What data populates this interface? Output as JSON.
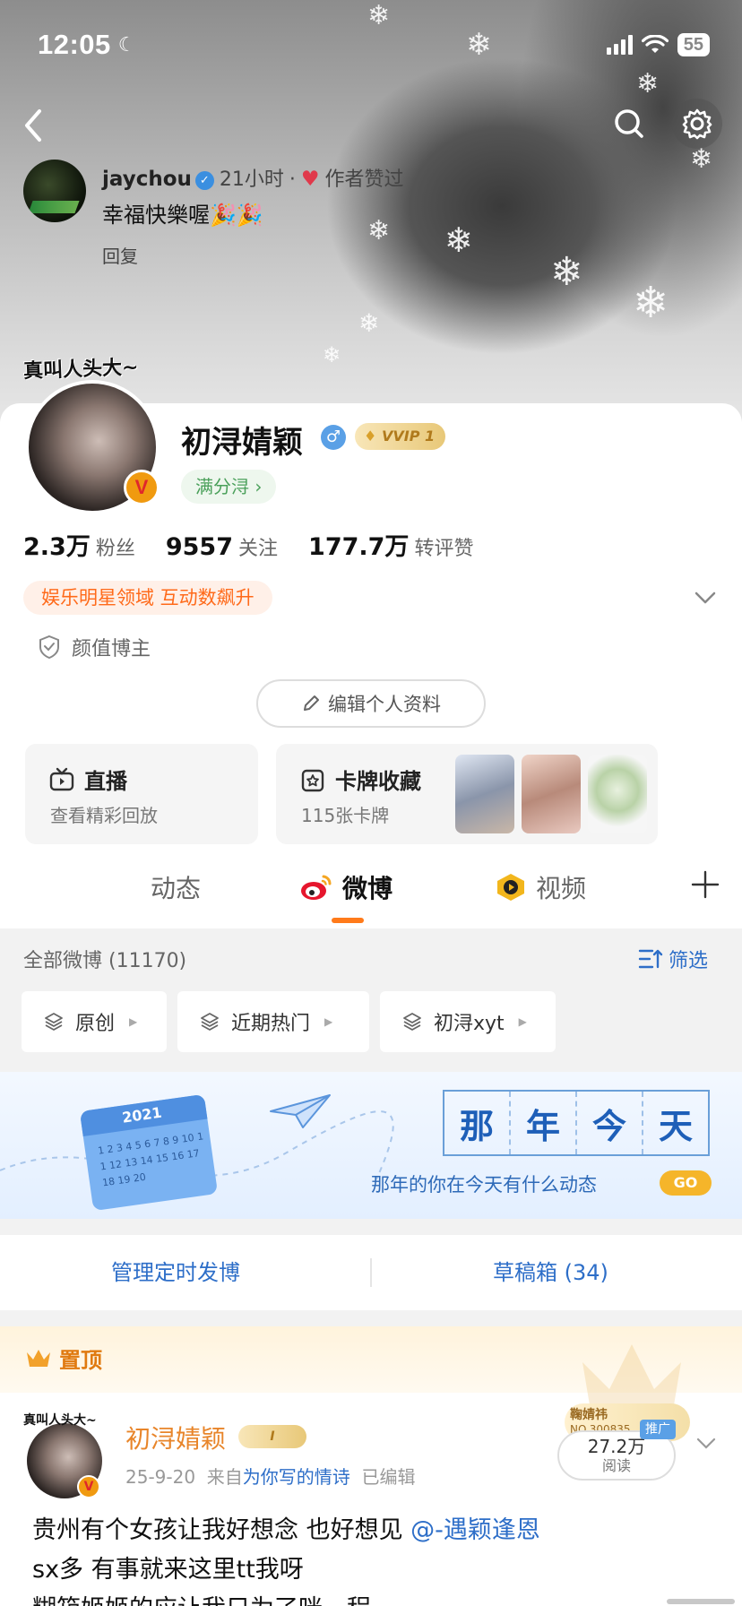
{
  "status_bar": {
    "time": "12:05",
    "battery": "55"
  },
  "header": {
    "back": "back-arrow-icon",
    "search": "search-icon",
    "settings": "gear-icon"
  },
  "top_comment": {
    "user": "jaychou",
    "time": "21小时",
    "liked_by_author": "作者赞过",
    "text": "幸福快樂喔🎉🎉",
    "reply": "回复"
  },
  "profile": {
    "avatar_tag": "真叫人头大~",
    "name": "初浔婧颖",
    "gender_icon": "♂",
    "vip": "VVIP 1",
    "score_tag": "满分浔 ›",
    "stats": [
      {
        "num": "2.3万",
        "label": "粉丝"
      },
      {
        "num": "9557",
        "label": "关注"
      },
      {
        "num": "177.7万",
        "label": "转评赞"
      }
    ],
    "domain_tag": "娱乐明星领域 互动数飙升",
    "category": "颜值博主",
    "edit_button": "编辑个人资料"
  },
  "tiles": {
    "live": {
      "title": "直播",
      "sub": "查看精彩回放"
    },
    "cards": {
      "title": "卡牌收藏",
      "sub": "115张卡牌"
    }
  },
  "tabs": [
    {
      "label": "动态",
      "active": false
    },
    {
      "label": "微博",
      "active": true
    },
    {
      "label": "视频",
      "active": false
    }
  ],
  "feed": {
    "count": "全部微博 (11170)",
    "filter": "筛选",
    "chips": [
      "原创",
      "近期热门",
      "初浔xyt"
    ]
  },
  "banner": {
    "year": "2021",
    "calendar_numbers": "1 2 3 4 5 6 7 8 9 10 11 12 13 14 15 16 17 18 19 20",
    "chars": [
      "那",
      "年",
      "今",
      "天"
    ],
    "subtitle": "那年的你在今天有什么动态",
    "go": "GO"
  },
  "actions": {
    "scheduled": "管理定时发博",
    "drafts": "草稿箱 (34)"
  },
  "pinned_post": {
    "pinned_label": "置顶",
    "avatar_tag": "真叫人头大~",
    "author": "初浔婧颖",
    "badge": "I",
    "date": "25-9-20",
    "from_prefix": "来自",
    "source": "为你写的情诗",
    "edited": "已编辑",
    "fan_card_name": "鞠婧祎",
    "fan_card_no": "NO.300835",
    "reads_value": "27.2万",
    "reads_label": "阅读",
    "promo": "推广",
    "text_1": "贵州有个女孩让我好想念 也好想见 ",
    "mention": "@-遇颖逢恩",
    "text_2": "sx多 有事就来这里tt我呀",
    "text_3": "糊箱姬姬的应让我只为了咪一程..."
  },
  "colors": {
    "accent": "#ff7a1a",
    "link": "#2d6ec8",
    "pinned": "#e07a10"
  }
}
